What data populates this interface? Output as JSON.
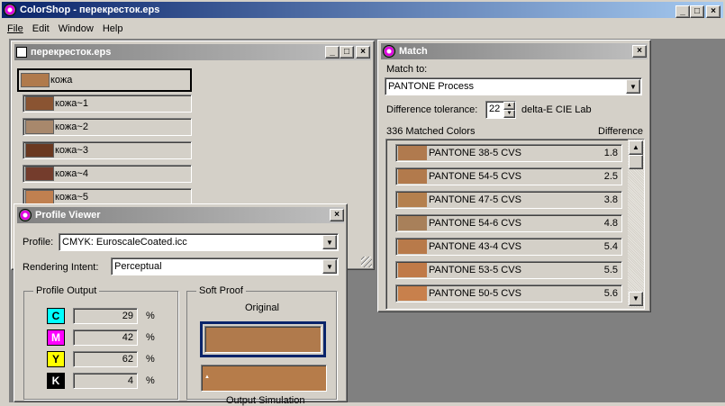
{
  "app": {
    "title": "ColorShop - перекресток.eps",
    "menu": [
      "File",
      "Edit",
      "Window",
      "Help"
    ]
  },
  "doc_window": {
    "title": "перекресток.eps",
    "swatches": [
      {
        "name": "кожа",
        "color": "#b07a4c"
      },
      {
        "name": "кожа~1",
        "color": "#8a5432"
      },
      {
        "name": "кожа~2",
        "color": "#a8886c"
      },
      {
        "name": "кожа~3",
        "color": "#6a3820"
      },
      {
        "name": "кожа~4",
        "color": "#743c2c"
      },
      {
        "name": "кожа~5",
        "color": "#c08050"
      }
    ]
  },
  "match_window": {
    "title": "Match",
    "match_to_label": "Match to:",
    "match_to_value": "PANTONE Process",
    "tolerance_label": "Difference tolerance:",
    "tolerance_value": "22",
    "tolerance_unit": "delta-E CIE Lab",
    "count_label": "336 Matched Colors",
    "difference_label": "Difference",
    "matches": [
      {
        "name": "PANTONE 38-5 CVS",
        "diff": "1.8",
        "color": "#b07a4e"
      },
      {
        "name": "PANTONE 54-5 CVS",
        "diff": "2.5",
        "color": "#b27a4c"
      },
      {
        "name": "PANTONE 47-5 CVS",
        "diff": "3.8",
        "color": "#b4804e"
      },
      {
        "name": "PANTONE 54-6 CVS",
        "diff": "4.8",
        "color": "#a8805a"
      },
      {
        "name": "PANTONE 43-4 CVS",
        "diff": "5.4",
        "color": "#b87a4a"
      },
      {
        "name": "PANTONE 53-5 CVS",
        "diff": "5.5",
        "color": "#c07a48"
      },
      {
        "name": "PANTONE 50-5 CVS",
        "diff": "5.6",
        "color": "#c8804c"
      }
    ]
  },
  "profile_window": {
    "title": "Profile Viewer",
    "profile_label": "Profile:",
    "profile_value": "CMYK: EuroscaleCoated.icc",
    "intent_label": "Rendering Intent:",
    "intent_value": "Perceptual",
    "output_label": "Profile Output",
    "channels": [
      {
        "letter": "C",
        "value": "29",
        "unit": "%",
        "color": "#00ffff"
      },
      {
        "letter": "M",
        "value": "42",
        "unit": "%",
        "color": "#ff00ff"
      },
      {
        "letter": "Y",
        "value": "62",
        "unit": "%",
        "color": "#ffff00"
      },
      {
        "letter": "K",
        "value": "4",
        "unit": "%",
        "color": "#000000"
      }
    ],
    "soft_proof_label": "Soft Proof",
    "original_label": "Original",
    "original_color": "#b07a4c",
    "simulated_color": "#b67c4a",
    "simulation_label": "Output Simulation"
  }
}
